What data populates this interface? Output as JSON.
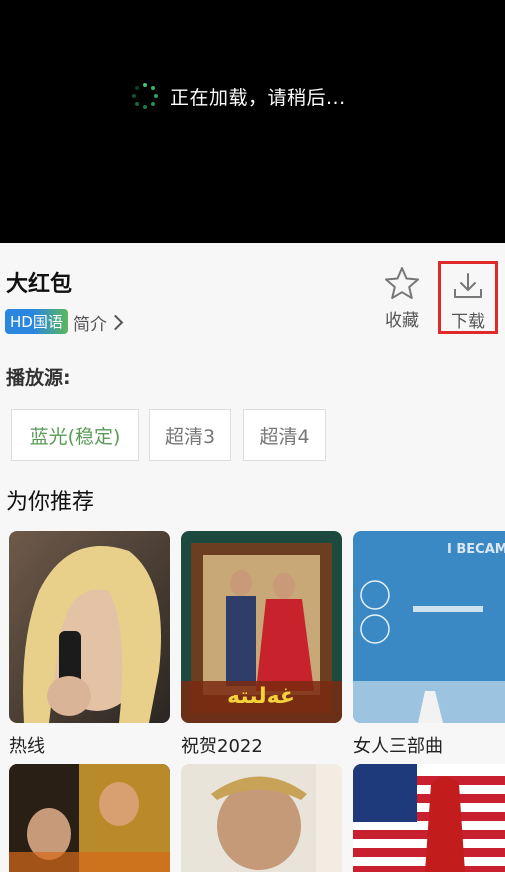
{
  "player": {
    "loading_text": "正在加载，请稍后..."
  },
  "movie": {
    "title": "大红包",
    "badge": "HD国语",
    "intro_label": "简介",
    "favorite_label": "收藏",
    "download_label": "下载"
  },
  "sources": {
    "label": "播放源:",
    "items": [
      {
        "label": "蓝光(稳定)",
        "active": true
      },
      {
        "label": "超清3",
        "active": false
      },
      {
        "label": "超清4",
        "active": false
      }
    ]
  },
  "recommend": {
    "title": "为你推荐",
    "items": [
      {
        "title": "热线"
      },
      {
        "title": "祝贺2022",
        "poster_text": "غەلىتە"
      },
      {
        "title": "女人三部曲",
        "poster_text": "I BECAME A WOMAN"
      },
      {
        "title": ""
      },
      {
        "title": ""
      },
      {
        "title": ""
      }
    ]
  },
  "colors": {
    "accent_green": "#36c978",
    "active_source": "#5a9a57",
    "highlight_red": "#e02a2a"
  },
  "icons": [
    "loading-spinner-icon",
    "star-icon",
    "download-icon",
    "chevron-right-icon"
  ]
}
